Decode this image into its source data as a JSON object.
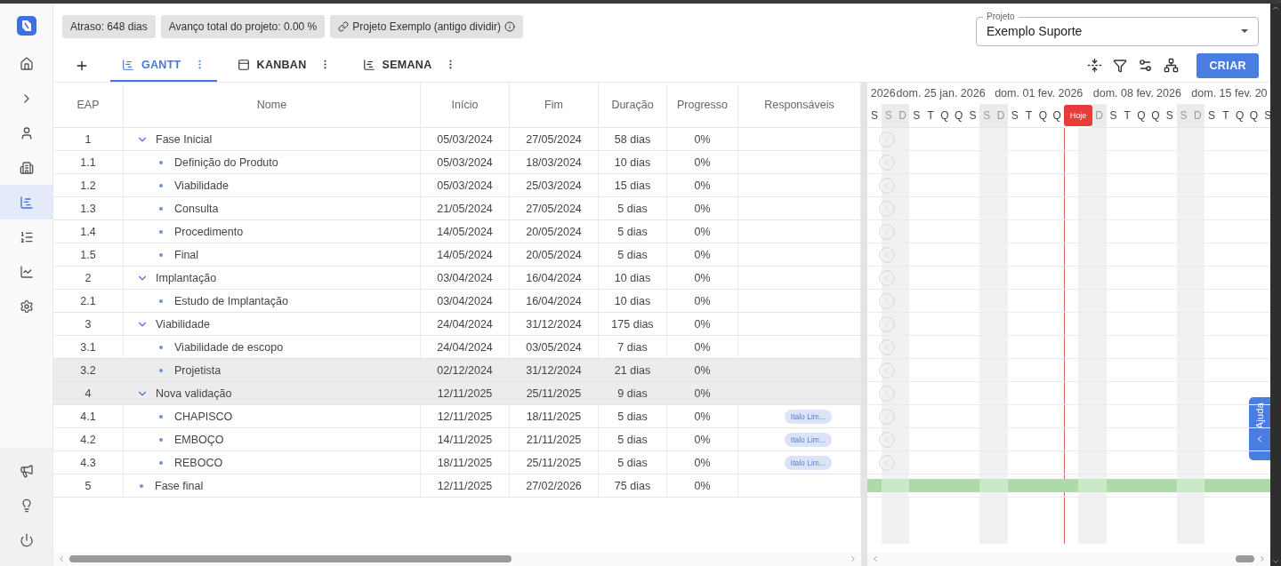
{
  "sidebar": {
    "items": [
      {
        "selected": false
      },
      {
        "selected": false
      },
      {
        "selected": false
      },
      {
        "selected": false
      },
      {
        "selected": true
      },
      {
        "selected": false
      },
      {
        "selected": false
      },
      {
        "selected": false
      }
    ],
    "bottom_items": [
      {
        "selected": false
      },
      {
        "selected": false
      },
      {
        "selected": false
      }
    ]
  },
  "header": {
    "chips": [
      {
        "kind": "text",
        "label": "Atraso: 648 dias"
      },
      {
        "kind": "text",
        "label": "Avanço total do projeto: 0.00 %"
      },
      {
        "kind": "link",
        "label": "Projeto Exemplo (antigo dividir)"
      }
    ],
    "project_select": {
      "label": "Projeto",
      "value": "Exemplo Suporte"
    }
  },
  "view_tabs": [
    {
      "label": "GANTT",
      "selected": true
    },
    {
      "label": "KANBAN",
      "selected": false
    },
    {
      "label": "SEMANA",
      "selected": false
    }
  ],
  "create_button": "CRIAR",
  "table": {
    "columns": [
      "EAP",
      "Nome",
      "Início",
      "Fim",
      "Duração",
      "Progresso",
      "Responsáveis"
    ],
    "rows": [
      {
        "wbs": "1",
        "name": "Fase Inicial",
        "start": "05/03/2024",
        "end": "27/05/2024",
        "duration": "58 dias",
        "progress": "0%",
        "highlighted": false,
        "expanded": true,
        "earlier_marker": true,
        "bar": false,
        "children": [
          {
            "wbs": "1.1",
            "name": "Definição do Produto",
            "start": "05/03/2024",
            "end": "18/03/2024",
            "duration": "10 dias",
            "progress": "0%",
            "highlighted": false,
            "earlier_marker": true,
            "bar": false
          },
          {
            "wbs": "1.2",
            "name": "Viabilidade",
            "start": "05/03/2024",
            "end": "25/03/2024",
            "duration": "15 dias",
            "progress": "0%",
            "highlighted": false,
            "earlier_marker": true,
            "bar": false
          },
          {
            "wbs": "1.3",
            "name": "Consulta",
            "start": "21/05/2024",
            "end": "27/05/2024",
            "duration": "5 dias",
            "progress": "0%",
            "highlighted": false,
            "earlier_marker": true,
            "bar": false
          },
          {
            "wbs": "1.4",
            "name": "Procedimento",
            "start": "14/05/2024",
            "end": "20/05/2024",
            "duration": "5 dias",
            "progress": "0%",
            "highlighted": false,
            "earlier_marker": true,
            "bar": false
          },
          {
            "wbs": "1.5",
            "name": "Final",
            "start": "14/05/2024",
            "end": "20/05/2024",
            "duration": "5 dias",
            "progress": "0%",
            "highlighted": false,
            "earlier_marker": true,
            "bar": false
          }
        ]
      },
      {
        "wbs": "2",
        "name": "Implantação",
        "start": "03/04/2024",
        "end": "16/04/2024",
        "duration": "10 dias",
        "progress": "0%",
        "highlighted": false,
        "expanded": true,
        "earlier_marker": true,
        "bar": false,
        "children": [
          {
            "wbs": "2.1",
            "name": "Estudo de Implantação",
            "start": "03/04/2024",
            "end": "16/04/2024",
            "duration": "10 dias",
            "progress": "0%",
            "highlighted": false,
            "earlier_marker": true,
            "bar": false
          }
        ]
      },
      {
        "wbs": "3",
        "name": "Viabilidade",
        "start": "24/04/2024",
        "end": "31/12/2024",
        "duration": "175 dias",
        "progress": "0%",
        "highlighted": false,
        "expanded": true,
        "earlier_marker": true,
        "bar": false,
        "children": [
          {
            "wbs": "3.1",
            "name": "Viabilidade de escopo",
            "start": "24/04/2024",
            "end": "03/05/2024",
            "duration": "7 dias",
            "progress": "0%",
            "highlighted": false,
            "earlier_marker": true,
            "bar": false
          },
          {
            "wbs": "3.2",
            "name": "Projetista",
            "start": "02/12/2024",
            "end": "31/12/2024",
            "duration": "21 dias",
            "progress": "0%",
            "highlighted": true,
            "earlier_marker": true,
            "bar": false
          }
        ]
      },
      {
        "wbs": "4",
        "name": "Nova validação",
        "start": "12/11/2025",
        "end": "25/11/2025",
        "duration": "9 dias",
        "progress": "0%",
        "highlighted": true,
        "expanded": true,
        "earlier_marker": true,
        "bar": false,
        "children": [
          {
            "wbs": "4.1",
            "name": "CHAPISCO",
            "start": "12/11/2025",
            "end": "18/11/2025",
            "duration": "5 dias",
            "progress": "0%",
            "highlighted": false,
            "earlier_marker": true,
            "bar": false,
            "assignees": [
              "Italo Lim..."
            ]
          },
          {
            "wbs": "4.2",
            "name": "EMBOÇO",
            "start": "14/11/2025",
            "end": "21/11/2025",
            "duration": "5 dias",
            "progress": "0%",
            "highlighted": false,
            "earlier_marker": true,
            "bar": false,
            "assignees": [
              "Italo Lim..."
            ]
          },
          {
            "wbs": "4.3",
            "name": "REBOCO",
            "start": "18/11/2025",
            "end": "25/11/2025",
            "duration": "5 dias",
            "progress": "0%",
            "highlighted": false,
            "earlier_marker": true,
            "bar": false,
            "assignees": [
              "Italo Lim..."
            ]
          }
        ]
      },
      {
        "wbs": "5",
        "name": "Fase final",
        "start": "12/11/2025",
        "end": "27/02/2026",
        "duration": "75 dias",
        "progress": "0%",
        "highlighted": false,
        "earlier_marker": false,
        "bar": true
      }
    ]
  },
  "timeline": {
    "weeks": [
      "2026",
      "dom. 25 jan. 2026",
      "dom. 01 fev. 2026",
      "dom. 08 fev. 2026",
      "dom. 15 fev. 20"
    ],
    "days": [
      {
        "kind": "day",
        "letter": "S",
        "weekend": false
      },
      {
        "kind": "day",
        "letter": "S",
        "weekend": true
      },
      {
        "kind": "day",
        "letter": "D",
        "weekend": true
      },
      {
        "kind": "day",
        "letter": "S",
        "weekend": false
      },
      {
        "kind": "day",
        "letter": "T",
        "weekend": false
      },
      {
        "kind": "day",
        "letter": "Q",
        "weekend": false
      },
      {
        "kind": "day",
        "letter": "Q",
        "weekend": false
      },
      {
        "kind": "day",
        "letter": "S",
        "weekend": false
      },
      {
        "kind": "day",
        "letter": "S",
        "weekend": true
      },
      {
        "kind": "day",
        "letter": "D",
        "weekend": true
      },
      {
        "kind": "day",
        "letter": "S",
        "weekend": false
      },
      {
        "kind": "day",
        "letter": "T",
        "weekend": false
      },
      {
        "kind": "day",
        "letter": "Q",
        "weekend": false
      },
      {
        "kind": "day",
        "letter": "Q",
        "weekend": false
      },
      {
        "kind": "today",
        "label": "Hoje"
      },
      {
        "kind": "day",
        "letter": "D",
        "weekend": true
      },
      {
        "kind": "day",
        "letter": "S",
        "weekend": false
      },
      {
        "kind": "day",
        "letter": "T",
        "weekend": false
      },
      {
        "kind": "day",
        "letter": "Q",
        "weekend": false
      },
      {
        "kind": "day",
        "letter": "Q",
        "weekend": false
      },
      {
        "kind": "day",
        "letter": "S",
        "weekend": false
      },
      {
        "kind": "day",
        "letter": "S",
        "weekend": true
      },
      {
        "kind": "day",
        "letter": "D",
        "weekend": true
      },
      {
        "kind": "day",
        "letter": "S",
        "weekend": false
      },
      {
        "kind": "day",
        "letter": "T",
        "weekend": false
      },
      {
        "kind": "day",
        "letter": "Q",
        "weekend": false
      },
      {
        "kind": "day",
        "letter": "Q",
        "weekend": false
      },
      {
        "kind": "day",
        "letter": "S",
        "weekend": false
      }
    ]
  },
  "help_tab": "Ajuda"
}
